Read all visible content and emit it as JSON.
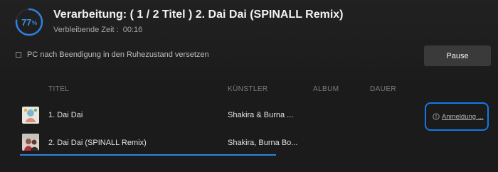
{
  "progress": {
    "percent_value": 77,
    "number": "77",
    "unit": "%",
    "ring_color": "#2f80e0"
  },
  "status": {
    "title": "Verarbeitung: ( 1 / 2 Titel ) 2. Dai Dai (SPINALL Remix)",
    "remaining_label": "Verbleibende Zeit :",
    "remaining_value": "00:16"
  },
  "options": {
    "sleep_label": "PC nach Beendigung in den Ruhezustand versetzen",
    "sleep_checked": false
  },
  "controls": {
    "pause_label": "Pause"
  },
  "table": {
    "columns": [
      "TITEL",
      "KÜNSTLER",
      "ALBUM",
      "DAUER"
    ],
    "rows": [
      {
        "title": "1. Dai Dai",
        "artist": "Shakira & Burna ...",
        "album": "",
        "duration": "",
        "action": "Anmeldung ..."
      },
      {
        "title": "2. Dai Dai (SPINALL Remix)",
        "artist": "Shakira, Burna Bo...",
        "album": "",
        "duration": "",
        "action": ""
      }
    ]
  },
  "icons": {
    "action_icon": "info-circle-icon",
    "thumb_icon": "album-art-icon"
  },
  "colors": {
    "accent": "#2f80e0",
    "highlight_border": "#1478e6",
    "background": "#1b1b1b"
  }
}
